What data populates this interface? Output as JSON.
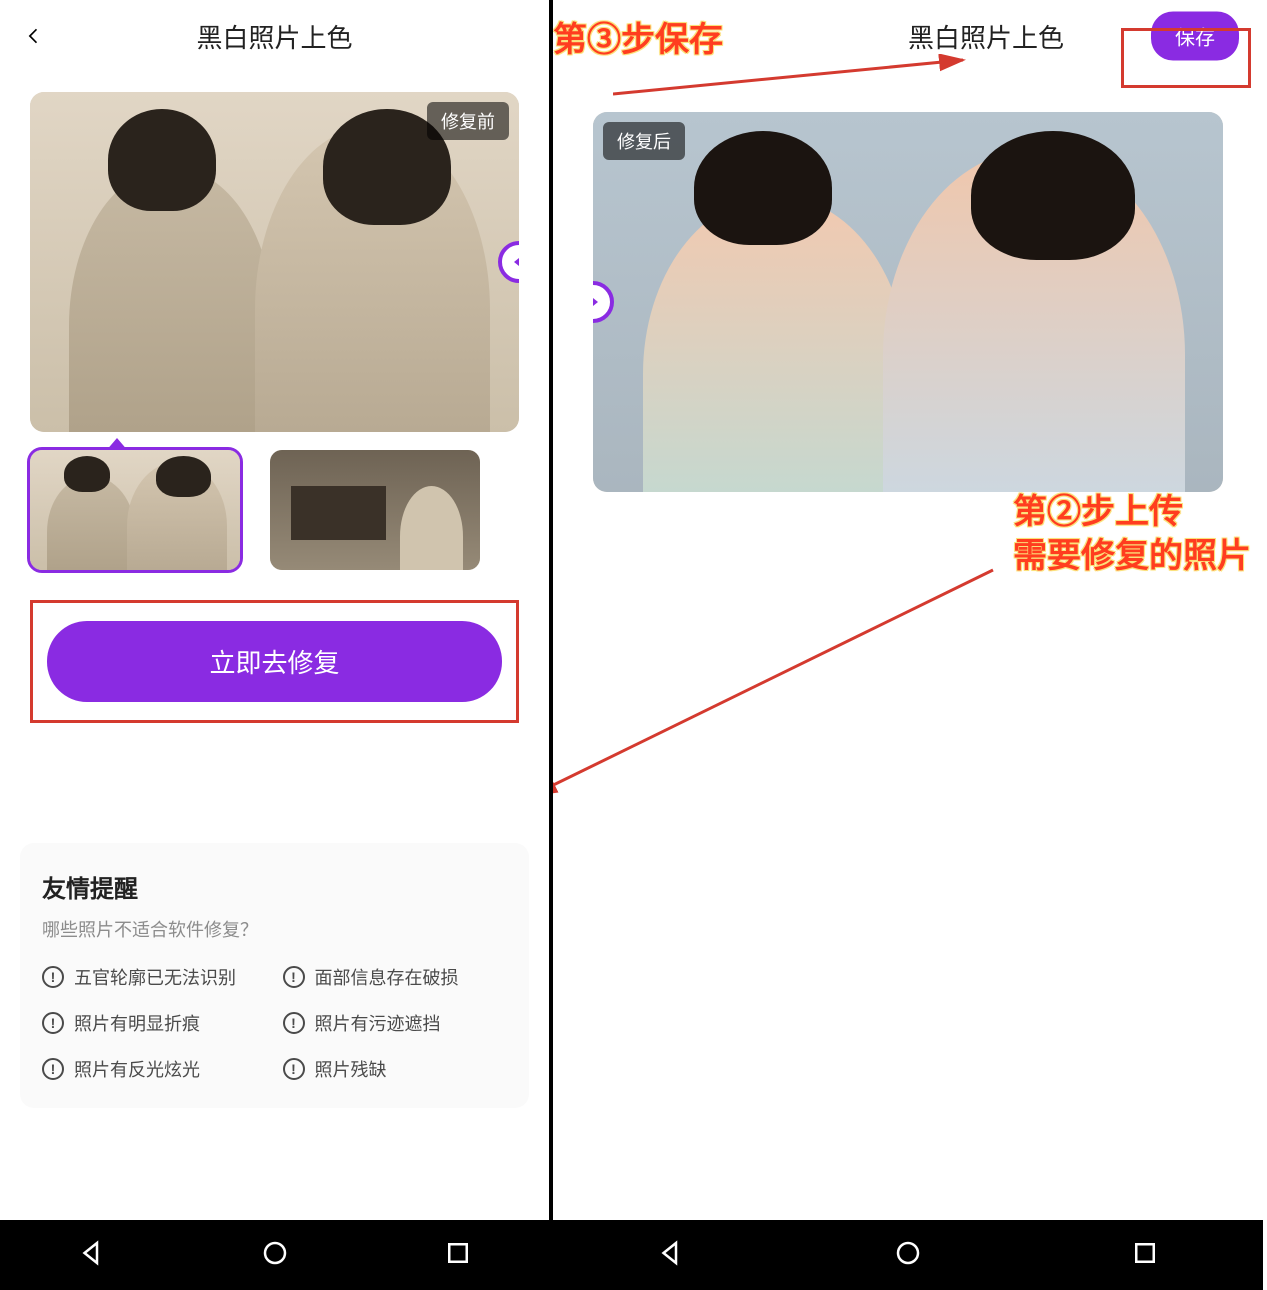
{
  "colors": {
    "accent": "#8a2be2",
    "danger": "#d43a2f"
  },
  "left": {
    "title": "黑白照片上色",
    "preview_badge": "修复前",
    "thumb_selected_index": 0,
    "fix_button": "立即去修复",
    "reminder": {
      "heading": "友情提醒",
      "sub": "哪些照片不适合软件修复？",
      "tips": [
        "五官轮廓已无法识别",
        "面部信息存在破损",
        "照片有明显折痕",
        "照片有污迹遮挡",
        "照片有反光炫光",
        "照片残缺"
      ]
    }
  },
  "right": {
    "title": "黑白照片上色",
    "save_button": "保存",
    "preview_badge": "修复后",
    "annotations": {
      "step3": "第③步保存",
      "step2_line1": "第②步上传",
      "step2_line2": "需要修复的照片"
    }
  }
}
